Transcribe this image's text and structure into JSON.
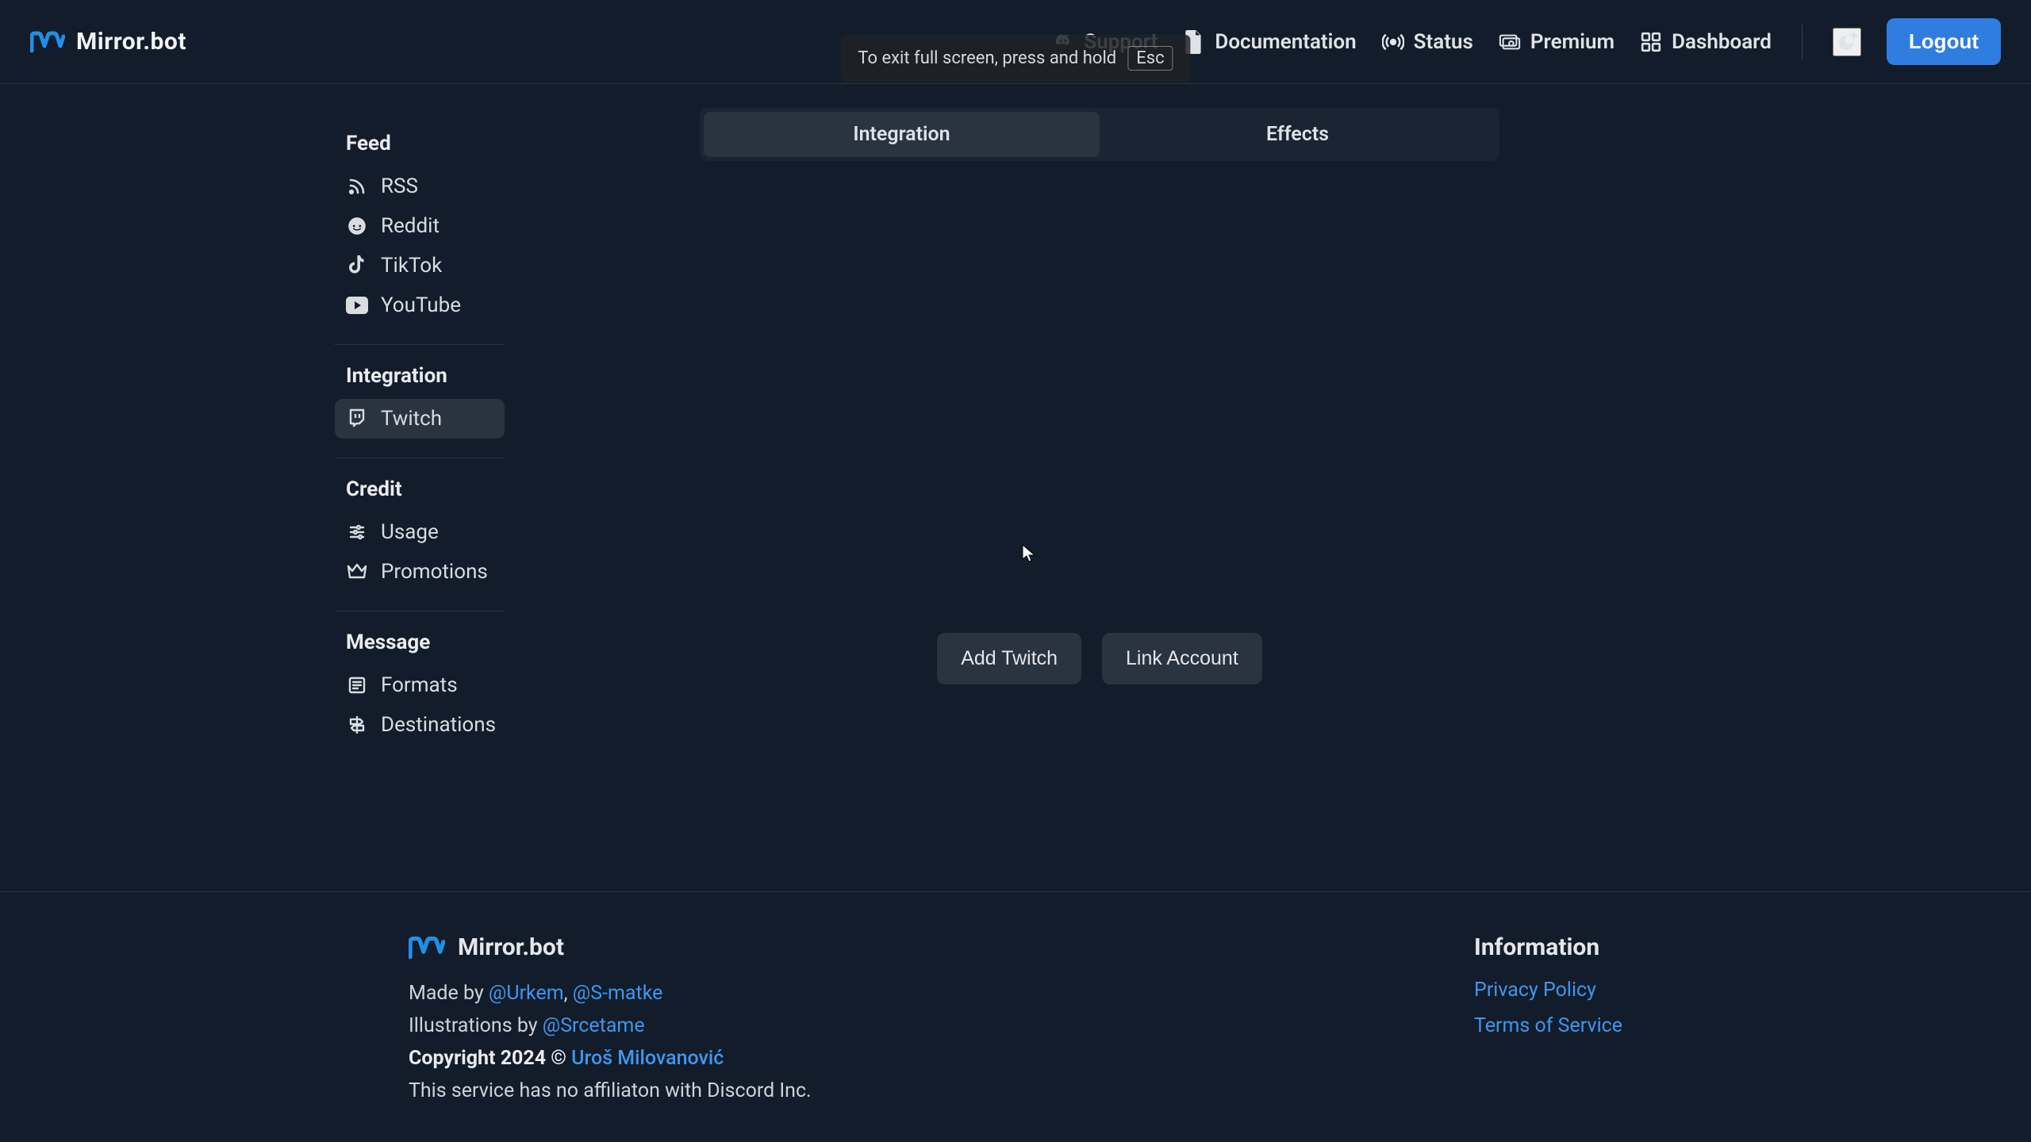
{
  "brand": {
    "name": "Mirror.bot"
  },
  "esc_toast": {
    "text": "To exit full screen, press and hold",
    "key": "Esc"
  },
  "nav": {
    "support": "Support",
    "documentation": "Documentation",
    "status": "Status",
    "premium": "Premium",
    "dashboard": "Dashboard",
    "logout": "Logout"
  },
  "sidebar": {
    "sections": [
      {
        "heading": "Feed",
        "items": [
          {
            "id": "rss",
            "label": "RSS"
          },
          {
            "id": "reddit",
            "label": "Reddit"
          },
          {
            "id": "tiktok",
            "label": "TikTok"
          },
          {
            "id": "youtube",
            "label": "YouTube"
          }
        ]
      },
      {
        "heading": "Integration",
        "items": [
          {
            "id": "twitch",
            "label": "Twitch",
            "active": true
          }
        ]
      },
      {
        "heading": "Credit",
        "items": [
          {
            "id": "usage",
            "label": "Usage"
          },
          {
            "id": "promotions",
            "label": "Promotions"
          }
        ]
      },
      {
        "heading": "Message",
        "items": [
          {
            "id": "formats",
            "label": "Formats"
          },
          {
            "id": "destinations",
            "label": "Destinations"
          }
        ]
      }
    ]
  },
  "tabs": {
    "integration": "Integration",
    "effects": "Effects"
  },
  "main": {
    "add_twitch": "Add Twitch",
    "link_account": "Link Account"
  },
  "footer": {
    "brand": "Mirror.bot",
    "made_by_prefix": "Made by ",
    "made_by_1": "@Urkem",
    "made_by_sep": ", ",
    "made_by_2": "@S-matke",
    "illus_prefix": "Illustrations by ",
    "illus_by": "@Srcetame",
    "copyright_prefix": "Copyright 2024 © ",
    "copyright_name": "Uroš Milovanović",
    "disclaimer": "This service has no affiliaton with Discord Inc.",
    "info_heading": "Information",
    "privacy": "Privacy Policy",
    "tos": "Terms of Service"
  }
}
